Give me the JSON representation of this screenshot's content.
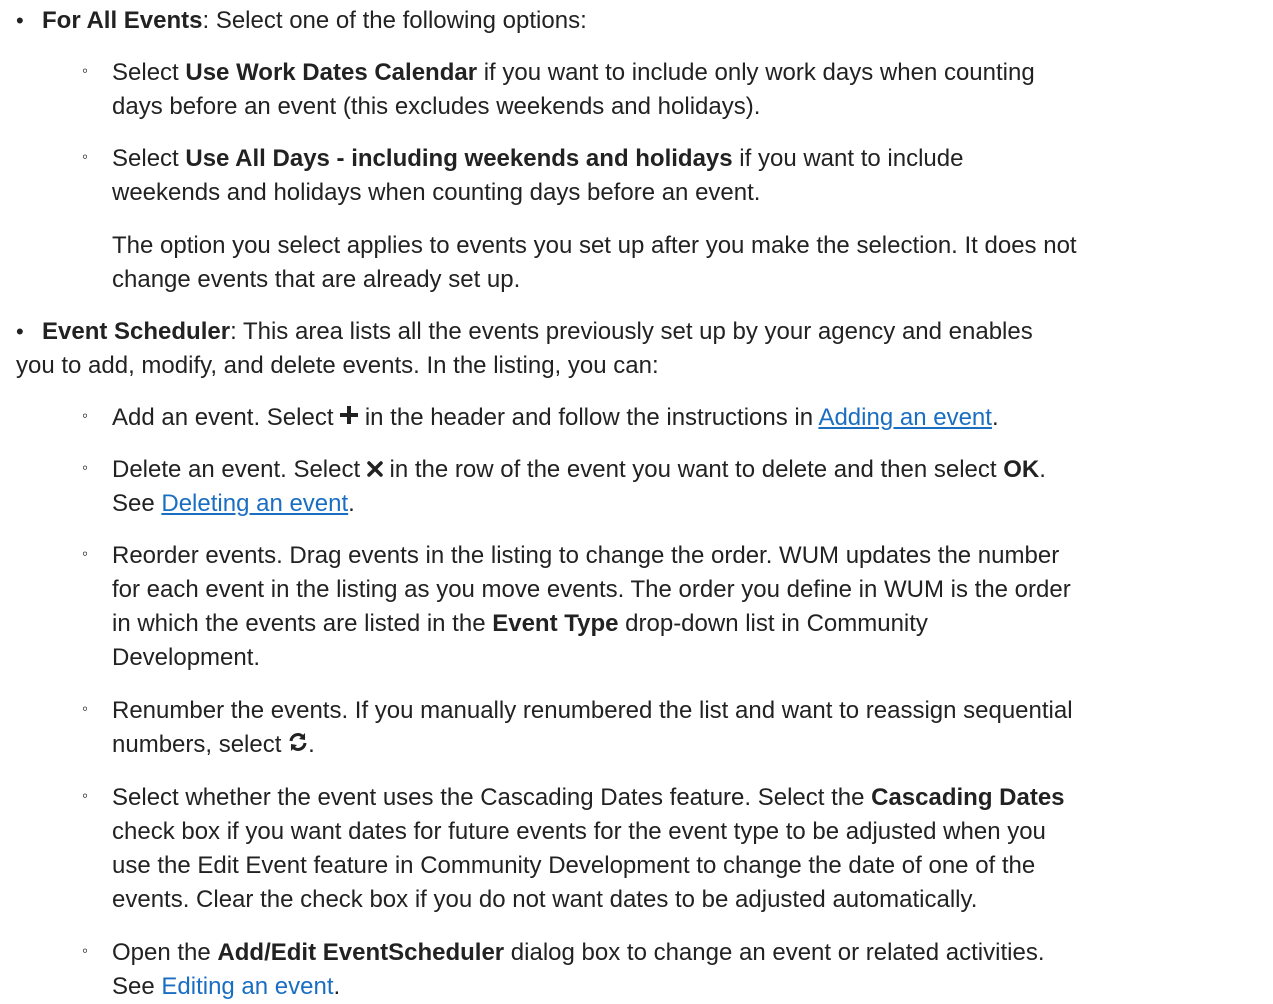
{
  "for_all_events": {
    "label": "For All Events",
    "text": ": Select one of the following options:",
    "options": [
      {
        "pre": "Select ",
        "bold": "Use Work Dates Calendar",
        "post_line1": " if you want to include only work days when counting",
        "post_line2": "days before an event (this excludes weekends and holidays)."
      },
      {
        "pre": "Select ",
        "bold": "Use All Days - including weekends and holidays",
        "post_line1": " if you want to include",
        "post_line2": "weekends and holidays when counting days before an event."
      }
    ],
    "note_line1": "The option you select applies to events you set up after you make the selection. It does not",
    "note_line2": "change events that are already set up."
  },
  "event_scheduler": {
    "label": "Event Scheduler",
    "text_line1": ": This area lists all the events previously set up by your agency and enables",
    "text_line2": "you to add, modify, and delete events. In the listing, you can:",
    "add": {
      "pre": "Add an event. Select ",
      "post": " in the header and follow the instructions in ",
      "link": "Adding an event",
      "end": ".",
      "icon": "plus-icon"
    },
    "delete": {
      "pre": "Delete an event. Select ",
      "post": " in the row of the event you want to delete and then select ",
      "bold": "OK",
      "end": ".",
      "see": "See ",
      "link": "Deleting an event",
      "end2": ".",
      "icon": "close-icon"
    },
    "reorder": {
      "line1": "Reorder events. Drag events in the listing to change the order. WUM updates the number",
      "line2": "for each event in the listing as you move events. The order you define in WUM is the order",
      "line3_pre": "in which the events are listed in the ",
      "bold": "Event Type",
      "line3_post": " drop-down list in Community",
      "line4": "Development."
    },
    "renumber": {
      "line1": "Renumber the events. If you manually renumbered the list and want to reassign sequential",
      "line2_pre": "numbers, select ",
      "end": ".",
      "icon": "refresh-icon"
    },
    "cascading": {
      "pre": "Select whether the event uses the Cascading Dates feature. Select the ",
      "bold": "Cascading Dates",
      "line2": "check box if you want dates for future events for the event type to be adjusted when you",
      "line3": "use the Edit Event feature in Community Development to change the date of one of the",
      "line4": "events. Clear the check box if you do not want dates to be adjusted automatically."
    },
    "open": {
      "pre": "Open the ",
      "bold": "Add/Edit EventScheduler",
      "post": " dialog box to change an event or related activities.",
      "see": "See ",
      "link": "Editing an event",
      "end": "."
    }
  },
  "colors": {
    "text": "#222222",
    "link": "#1a6ec2"
  }
}
